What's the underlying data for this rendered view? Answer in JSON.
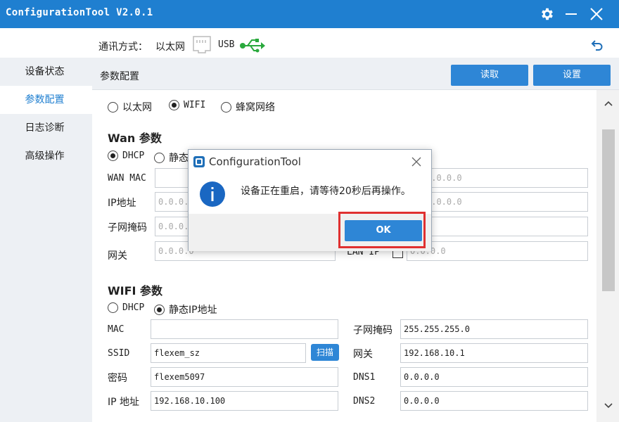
{
  "window": {
    "title": "ConfigurationTool V2.0.1"
  },
  "comm": {
    "label": "通讯方式：",
    "ethernet": "以太网",
    "usb": "USB"
  },
  "sidebar": {
    "items": [
      {
        "label": "设备状态"
      },
      {
        "label": "参数配置"
      },
      {
        "label": "日志诊断"
      },
      {
        "label": "高级操作"
      }
    ]
  },
  "main": {
    "title": "参数配置",
    "read_button": "读取",
    "set_button": "设置"
  },
  "network": {
    "options": [
      "以太网",
      "WIFI",
      "蜂窝网络"
    ],
    "selected": "WIFI"
  },
  "wan": {
    "title": "Wan 参数",
    "mode_options": [
      "DHCP",
      "静态"
    ],
    "mode_selected": "DHCP",
    "labels": {
      "mac": "WAN MAC",
      "ip": "IP地址",
      "mask": "子网掩码",
      "gateway": "网关",
      "lan_ip": "LAN IP"
    },
    "values": {
      "mac": "",
      "ip": "0.0.0.0",
      "mask": "0.0.0.0",
      "gateway": "0.0.0.0",
      "right1": "0.0.0.0",
      "right2": "0.0.0.0",
      "right3": "",
      "lan_ip": "0.0.0.0"
    }
  },
  "wifi": {
    "title": "WIFI 参数",
    "mode_options": [
      "DHCP",
      "静态IP地址"
    ],
    "mode_selected": "静态IP地址",
    "labels": {
      "mac": "MAC",
      "ssid": "SSID",
      "password": "密码",
      "ip": "IP 地址",
      "mask": "子网掩码",
      "gateway": "网关",
      "dns1": "DNS1",
      "dns2": "DNS2"
    },
    "values": {
      "mac": "",
      "ssid": "flexem_sz",
      "password": "flexem5097",
      "ip": "192.168.10.100",
      "mask": "255.255.255.0",
      "gateway": "192.168.10.1",
      "dns1": "0.0.0.0",
      "dns2": "0.0.0.0"
    },
    "scan_button": "扫描"
  },
  "dialog": {
    "title": "ConfigurationTool",
    "message": "设备正在重启，请等待20秒后再操作。",
    "ok_button": "OK"
  },
  "colors": {
    "primary": "#1f7fd0",
    "button": "#2e86d6",
    "highlight": "#e03030",
    "sidebar_bg": "#edf0f4"
  },
  "icons": [
    "gear-icon",
    "minimize-icon",
    "close-icon",
    "ethernet-port-icon",
    "usb-icon",
    "back-icon",
    "chevron-up-icon",
    "chevron-down-icon",
    "info-icon",
    "app-icon"
  ]
}
